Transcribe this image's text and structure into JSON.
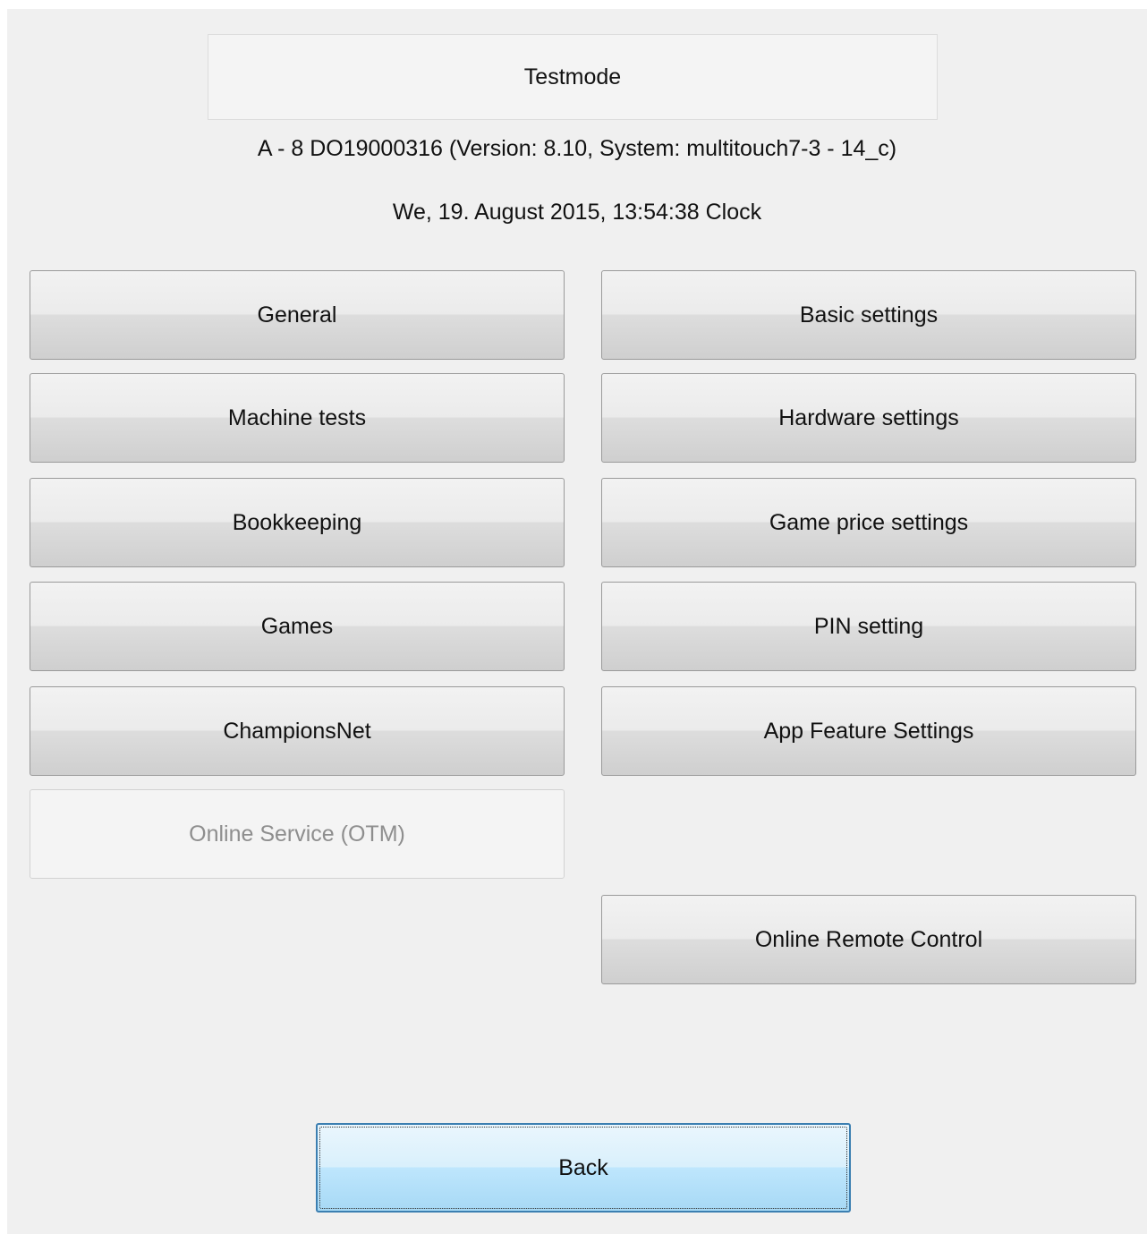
{
  "header": {
    "title": "Testmode",
    "machine_info": "A - 8 DO19000316 (Version: 8.10, System: multitouch7-3 - 14_c)",
    "datetime": "We, 19. August 2015, 13:54:38 Clock"
  },
  "menu": {
    "left": [
      {
        "label": "General",
        "enabled": true
      },
      {
        "label": "Machine tests",
        "enabled": true
      },
      {
        "label": "Bookkeeping",
        "enabled": true
      },
      {
        "label": "Games",
        "enabled": true
      },
      {
        "label": "ChampionsNet",
        "enabled": true
      },
      {
        "label": "Online Service (OTM)",
        "enabled": false
      }
    ],
    "right": [
      {
        "label": "Basic settings",
        "enabled": true
      },
      {
        "label": "Hardware settings",
        "enabled": true
      },
      {
        "label": "Game price settings",
        "enabled": true
      },
      {
        "label": "PIN setting",
        "enabled": true
      },
      {
        "label": "App Feature Settings",
        "enabled": true
      },
      {
        "label": "Online Remote Control",
        "enabled": true
      }
    ]
  },
  "footer": {
    "back_label": "Back"
  }
}
